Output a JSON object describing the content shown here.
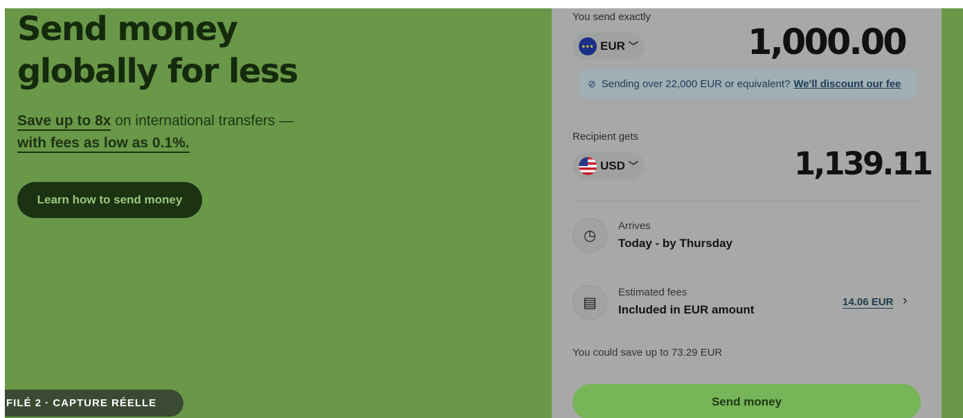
{
  "hero": {
    "title_line1": "Send money",
    "title_line2": "globally for less",
    "sub_highlight": "Save up to 8x",
    "sub_rest": " on international transfers —",
    "sub_line2": "with fees as low as 0.1%.",
    "cta_label": "Learn how to send money"
  },
  "sender": {
    "label": "You send exactly",
    "currency": "EUR",
    "flag_icon": "eu-flag-icon",
    "amount": "1,000.00"
  },
  "notice": {
    "text": "Sending over 22,000 EUR or equivalent?",
    "link": "We'll discount our fee"
  },
  "recipient": {
    "label": "Recipient gets",
    "currency": "USD",
    "flag_icon": "us-flag-icon",
    "amount": "1,139.11"
  },
  "arrival": {
    "label": "Arrives",
    "value": "Today - by Thursday"
  },
  "fees": {
    "label": "Estimated fees",
    "value": "Included in EUR amount",
    "amount": "14.06 EUR"
  },
  "savings_note": "You could save up to 73.29 EUR",
  "send_button": "Send money",
  "badge": "FILÉ 2 · CAPTURE RÉELLE",
  "colors": {
    "page_green": "#699848",
    "card_grey": "#a8a8a8",
    "button_green": "#78b458",
    "dark_green": "#1b3312"
  }
}
